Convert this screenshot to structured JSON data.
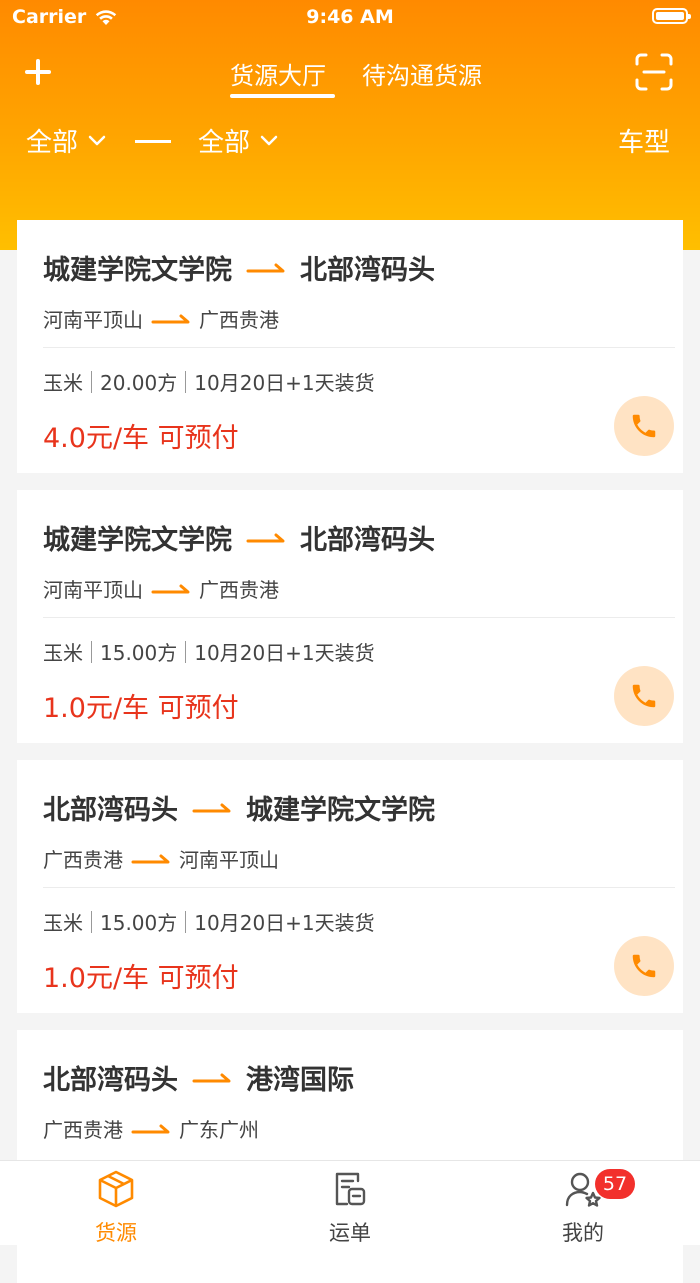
{
  "status_bar": {
    "carrier": "Carrier",
    "time": "9:46 AM"
  },
  "header": {
    "tabs": [
      {
        "label": "货源大厅",
        "active": true
      },
      {
        "label": "待沟通货源",
        "active": false
      }
    ],
    "filter_from": "全部",
    "filter_to": "全部",
    "filter_vehicle": "车型"
  },
  "colors": {
    "accent": "#ff8a00",
    "price": "#e8341c",
    "phone_bg": "#ffe3c4"
  },
  "cards": [
    {
      "from_place": "城建学院文学院",
      "to_place": "北部湾码头",
      "from_region": "河南平顶山",
      "to_region": "广西贵港",
      "cargo": "玉米",
      "volume": "20.00方",
      "load_time": "10月20日+1天装货",
      "price": "4.0元/车 可预付"
    },
    {
      "from_place": "城建学院文学院",
      "to_place": "北部湾码头",
      "from_region": "河南平顶山",
      "to_region": "广西贵港",
      "cargo": "玉米",
      "volume": "15.00方",
      "load_time": "10月20日+1天装货",
      "price": "1.0元/车 可预付"
    },
    {
      "from_place": "北部湾码头",
      "to_place": "城建学院文学院",
      "from_region": "广西贵港",
      "to_region": "河南平顶山",
      "cargo": "玉米",
      "volume": "15.00方",
      "load_time": "10月20日+1天装货",
      "price": "1.0元/车 可预付"
    },
    {
      "from_place": "北部湾码头",
      "to_place": "港湾国际",
      "from_region": "广西贵港",
      "to_region": "广东广州",
      "cargo": "",
      "volume": "",
      "load_time": "",
      "price": ""
    }
  ],
  "tabbar": {
    "items": [
      {
        "label": "货源",
        "icon": "box-icon",
        "active": true
      },
      {
        "label": "运单",
        "icon": "waybill-icon",
        "active": false
      },
      {
        "label": "我的",
        "icon": "user-icon",
        "active": false
      }
    ],
    "mine_badge": "57"
  }
}
